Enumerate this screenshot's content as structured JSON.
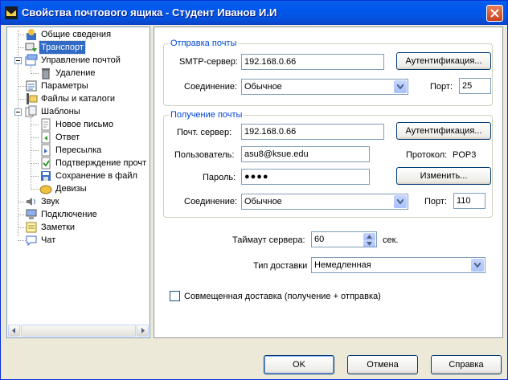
{
  "window": {
    "title": "Свойства почтового ящика - Студент Иванов И.И",
    "close_icon": "close-icon"
  },
  "tree": {
    "items": [
      {
        "label": "Общие сведения",
        "icon": "mailbox-info-icon",
        "selected": false
      },
      {
        "label": "Транспорт",
        "icon": "transport-icon",
        "selected": true
      },
      {
        "label": "Управление почтой",
        "icon": "mail-management-icon",
        "selected": false
      },
      {
        "label": "Удаление",
        "icon": "delete-icon",
        "selected": false
      },
      {
        "label": "Параметры",
        "icon": "parameters-icon",
        "selected": false
      },
      {
        "label": "Файлы и каталоги",
        "icon": "files-folders-icon",
        "selected": false
      },
      {
        "label": "Шаблоны",
        "icon": "templates-icon",
        "selected": false
      },
      {
        "label": "Новое письмо",
        "icon": "new-letter-icon",
        "selected": false
      },
      {
        "label": "Ответ",
        "icon": "reply-icon",
        "selected": false
      },
      {
        "label": "Пересылка",
        "icon": "forward-icon",
        "selected": false
      },
      {
        "label": "Подтверждение прочт",
        "icon": "read-confirm-icon",
        "selected": false
      },
      {
        "label": "Сохранение в файл",
        "icon": "save-to-file-icon",
        "selected": false
      },
      {
        "label": "Девизы",
        "icon": "mottos-icon",
        "selected": false
      },
      {
        "label": "Звук",
        "icon": "sound-icon",
        "selected": false
      },
      {
        "label": "Подключение",
        "icon": "connection-icon",
        "selected": false
      },
      {
        "label": "Заметки",
        "icon": "notes-icon",
        "selected": false
      },
      {
        "label": "Чат",
        "icon": "chat-icon",
        "selected": false
      }
    ]
  },
  "send": {
    "group_title": "Отправка почты",
    "smtp_label": "SMTP-сервер:",
    "smtp_value": "192.168.0.66",
    "auth_button": "Аутентификация...",
    "connection_label": "Соединение:",
    "connection_value": "Обычное",
    "port_label": "Порт:",
    "port_value": "25"
  },
  "receive": {
    "group_title": "Получение почты",
    "server_label": "Почт. сервер:",
    "server_value": "192.168.0.66",
    "auth_button": "Аутентификация...",
    "user_label": "Пользователь:",
    "user_value": "asu8@ksue.edu",
    "protocol_label": "Протокол:",
    "protocol_value": "POP3",
    "password_label": "Пароль:",
    "password_value": "●●●●",
    "change_button": "Изменить...",
    "connection_label": "Соединение:",
    "connection_value": "Обычное",
    "port_label": "Порт:",
    "port_value": "110"
  },
  "options": {
    "timeout_label": "Таймаут сервера:",
    "timeout_value": "60",
    "timeout_unit": "сек.",
    "delivery_label": "Тип доставки",
    "delivery_value": "Немедленная",
    "combined_label": "Совмещенная доставка (получение + отправка)",
    "combined_checked": false
  },
  "buttons": {
    "ok": "OK",
    "cancel": "Отмена",
    "help": "Справка"
  },
  "colors": {
    "titlebar": "#0058ee",
    "selection": "#316ac5",
    "group_title": "#0046d5",
    "dialog_bg": "#ece9d8"
  }
}
